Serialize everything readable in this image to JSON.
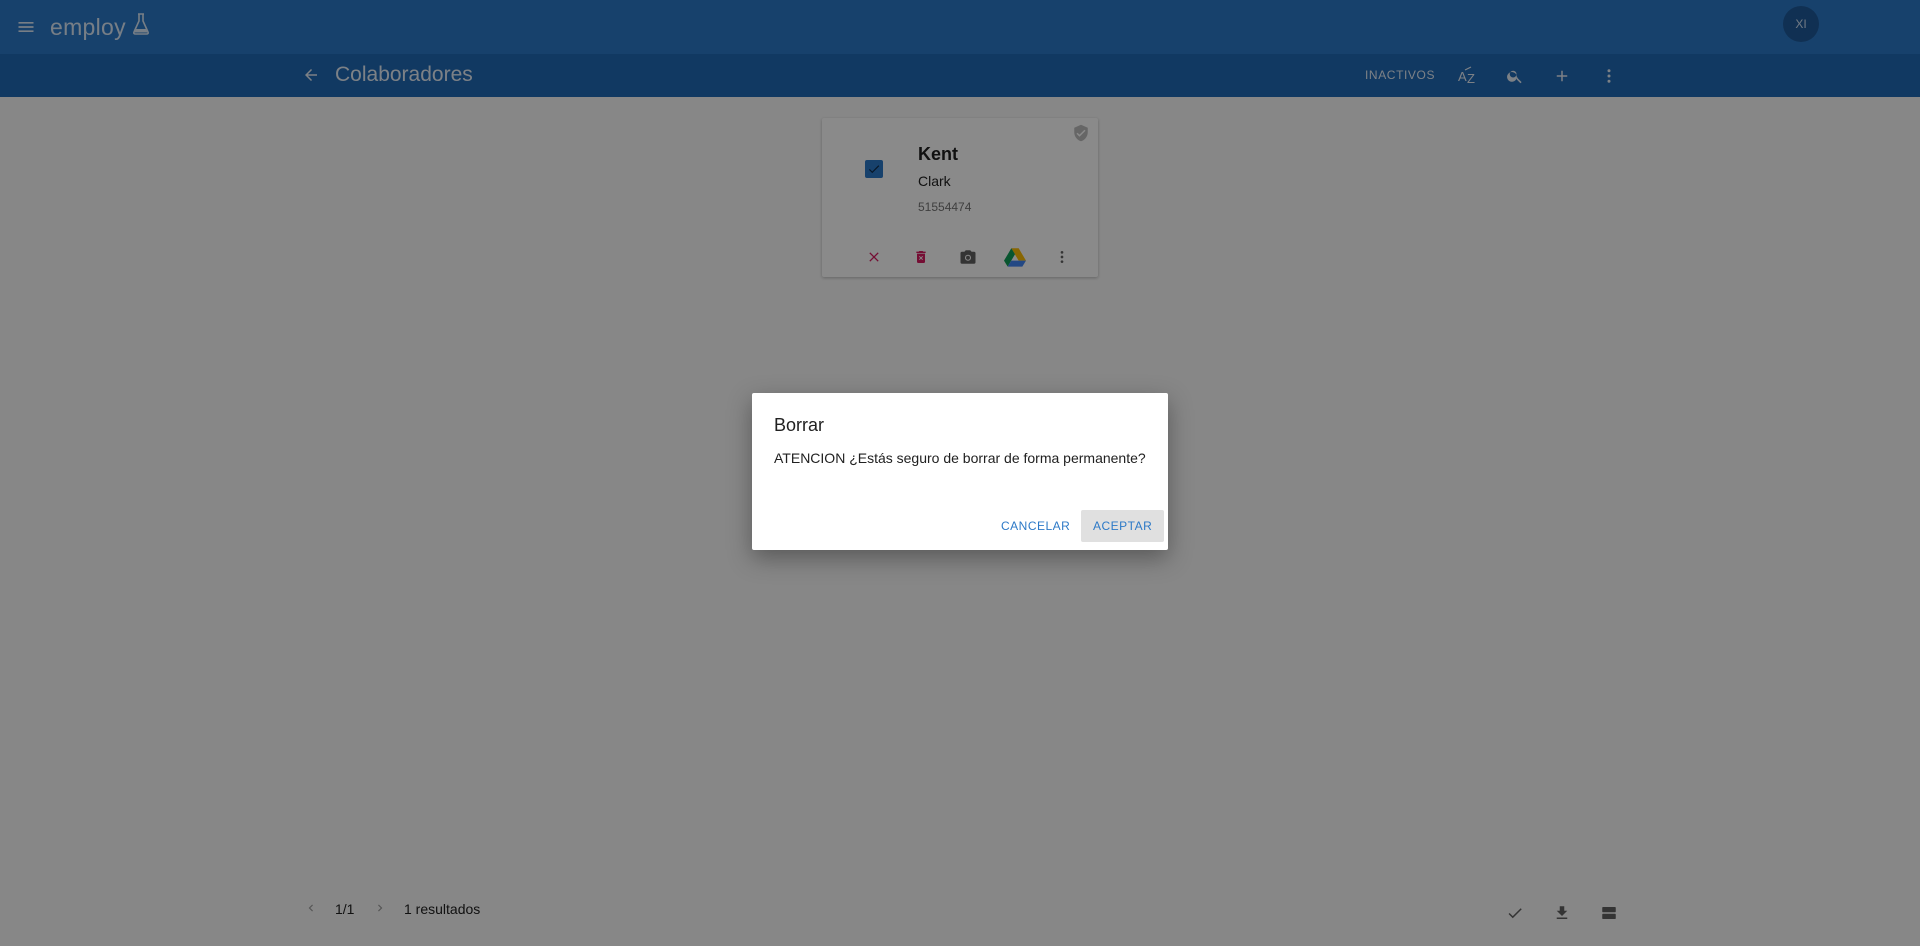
{
  "topbar": {
    "logo_text": "employ",
    "avatar_initials": "XI",
    "menu_icon": "menu-icon",
    "logo_icon": "flask-icon"
  },
  "toolbar": {
    "title": "Colaboradores",
    "inactive_label": "INACTIVOS",
    "back_icon": "arrow-back-icon",
    "sort_icon": "sort-az-icon",
    "search_icon": "search-icon",
    "add_icon": "add-icon",
    "more_icon": "more-vert-icon"
  },
  "card": {
    "first_name": "Kent",
    "last_name": "Clark",
    "id_number": "51554474",
    "checked": true,
    "actions": [
      "close-icon",
      "delete-icon",
      "camera-icon",
      "google-drive-icon",
      "more-vert-icon"
    ]
  },
  "footer": {
    "page": "1/1",
    "results": "1 resultados",
    "actions": [
      "check-icon",
      "download-icon",
      "view-agenda-icon"
    ]
  },
  "dialog": {
    "title": "Borrar",
    "message": "ATENCION ¿Estás seguro de borrar de forma permanente?",
    "cancel_label": "CANCELAR",
    "accept_label": "ACEPTAR"
  },
  "colors": {
    "topbar": "#2c79c7",
    "subbar": "#2169b5",
    "accent": "#2c79c7",
    "danger": "#d81b60"
  }
}
